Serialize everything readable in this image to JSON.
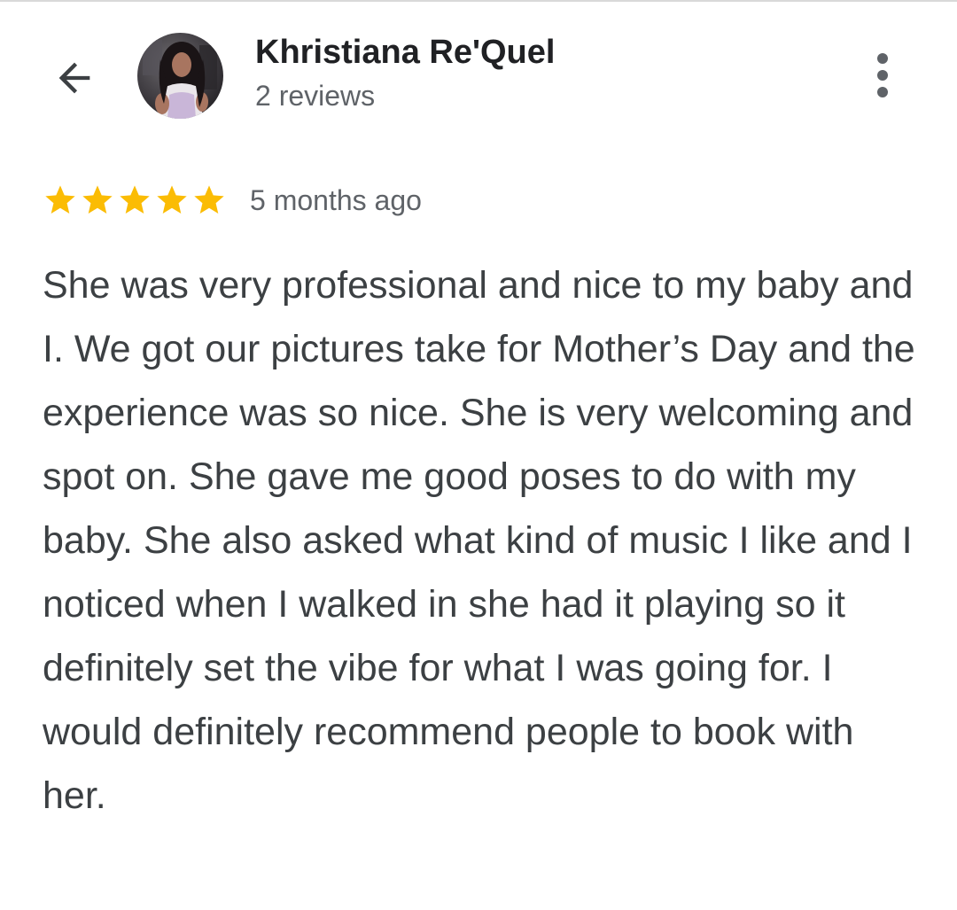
{
  "reviewer": {
    "name": "Khristiana Re'Quel",
    "review_count": "2 reviews"
  },
  "header": {
    "back_icon": "arrow-back-icon",
    "more_icon": "more-vert-icon"
  },
  "review": {
    "rating": 5,
    "max_rating": 5,
    "date": "5 months ago",
    "text": "She was very professional and nice to my baby and I. We got our pictures take for Mother’s Day and the experience was so nice. She is very welcoming and spot on. She gave me good poses to do with my baby. She also asked what kind of music I like and I noticed when I walked in she had it playing so it definitely set the vibe for what I was going for. I would definitely recommend people to book with her."
  },
  "colors": {
    "star": "#fbbc04",
    "name_text": "#202124",
    "secondary_text": "#5f6368",
    "body_text": "#3c4043",
    "background": "#ffffff"
  }
}
